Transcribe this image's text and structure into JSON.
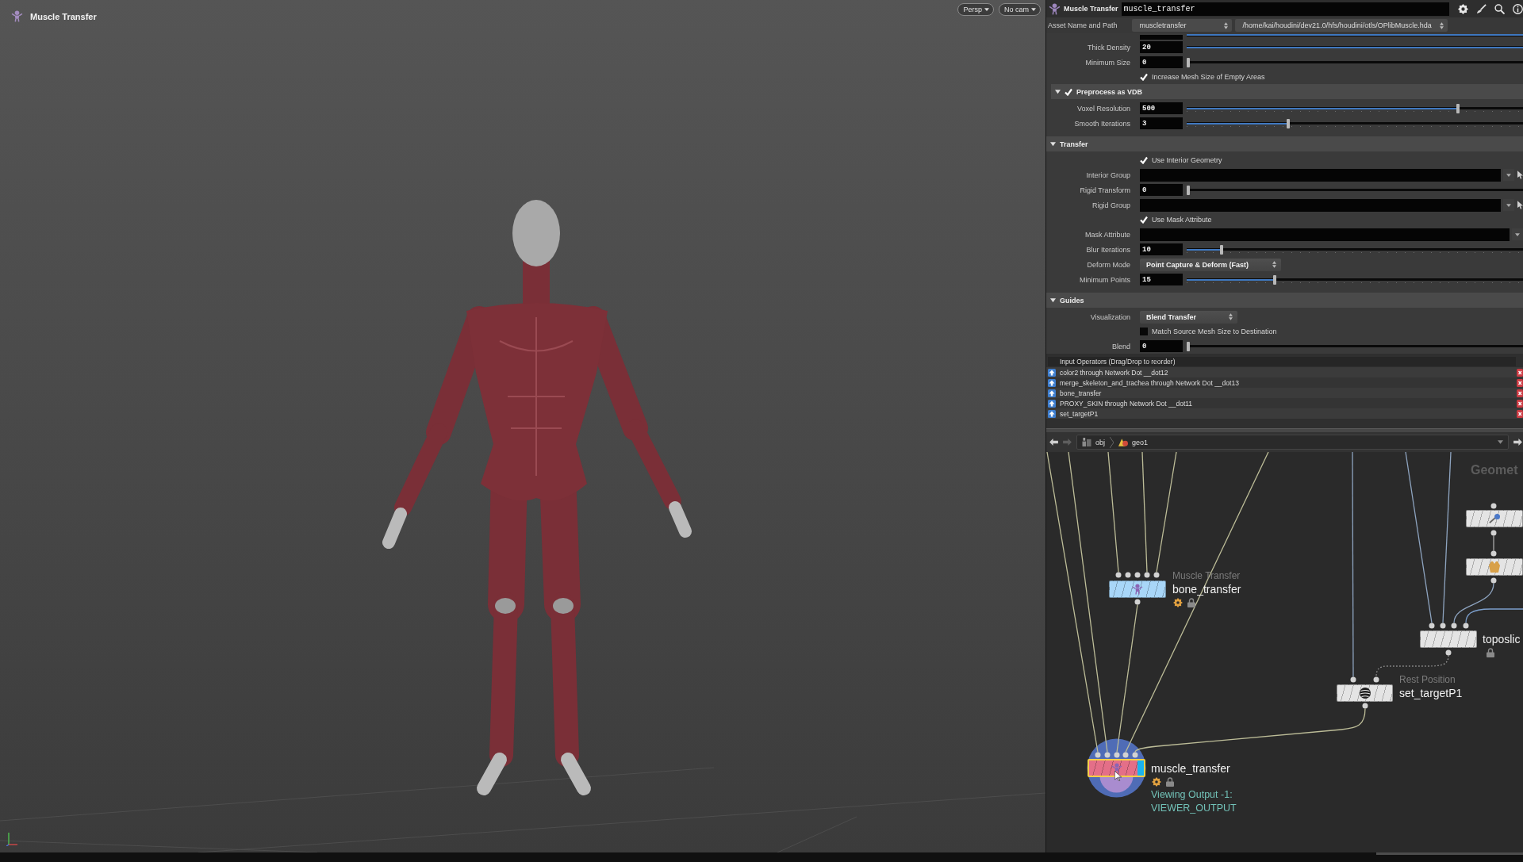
{
  "viewport": {
    "title": "Muscle Transfer",
    "buttons": [
      {
        "label": "Persp"
      },
      {
        "label": "No cam"
      }
    ]
  },
  "parameter_pane": {
    "node_type": "Muscle Transfer",
    "node_name": "muscle_transfer",
    "asset_label": "Asset Name and Path",
    "asset_name": "muscletransfer",
    "asset_path": "/home/kai/houdini/dev21.0/hfs/houdini/otls/OPlibMuscle.hda",
    "parameters": [
      {
        "kind": "folder",
        "children": [
          {
            "kind": "slider",
            "level": 1,
            "ticks": false
          },
          {
            "kind": "slider",
            "label": "Thick Density",
            "value": "20",
            "level": 1,
            "ticks": false
          },
          {
            "kind": "slider",
            "label": "Minimum Size",
            "value": "0",
            "level": 0,
            "ticks": false
          },
          {
            "kind": "checkbox",
            "label": "Increase Mesh Size of Empty Areas",
            "checked": true
          },
          {
            "kind": "folder",
            "label": "Preprocess as VDB",
            "expanded": true,
            "checked": true,
            "children": [
              {
                "kind": "slider",
                "label": "Voxel Resolution",
                "value": "500",
                "level": 0.81,
                "ticks": true
              },
              {
                "kind": "slider",
                "label": "Smooth Iterations",
                "value": "3",
                "level": 0.3,
                "ticks": true
              }
            ]
          }
        ]
      },
      {
        "kind": "folder",
        "label": "Transfer",
        "expanded": true,
        "children": [
          {
            "kind": "checkbox",
            "label": "Use Interior Geometry",
            "checked": true
          },
          {
            "kind": "string",
            "label": "Interior Group",
            "picker": true
          },
          {
            "kind": "slider",
            "label": "Rigid Transform",
            "value": "0",
            "level": 0,
            "ticks": false
          },
          {
            "kind": "string",
            "label": "Rigid Group",
            "picker": true
          },
          {
            "kind": "checkbox",
            "label": "Use Mask Attribute",
            "checked": true
          },
          {
            "kind": "string",
            "label": "Mask Attribute",
            "picker": false
          },
          {
            "kind": "slider",
            "label": "Blur Iterations",
            "value": "10",
            "level": 0.1,
            "ticks": true
          },
          {
            "kind": "menu",
            "label": "Deform Mode",
            "value": "Point Capture & Deform (Fast)"
          },
          {
            "kind": "slider",
            "label": "Minimum Points",
            "value": "15",
            "level": 0.26,
            "ticks": true
          }
        ]
      },
      {
        "kind": "folder",
        "label": "Guides",
        "expanded": true,
        "children": [
          {
            "kind": "menu",
            "label": "Visualization",
            "value": "Blend Transfer"
          },
          {
            "kind": "checkbox",
            "label": "Match Source Mesh Size to Destination",
            "checked": false
          },
          {
            "kind": "slider",
            "label": "Blend",
            "value": "0",
            "level": 0,
            "ticks": false
          }
        ]
      }
    ],
    "input_operators": {
      "header": "Input Operators (Drag/Drop to reorder)",
      "items": [
        {
          "label": "color2 through Network Dot __dot12"
        },
        {
          "label": "merge_skeleton_and_trachea through Network Dot __dot13"
        },
        {
          "label": "bone_transfer"
        },
        {
          "label": "PROXY_SKIN through Network Dot __dot11"
        },
        {
          "label": "set_targetP1"
        }
      ]
    }
  },
  "network_editor": {
    "back": {
      "disabled": false
    },
    "forward": {
      "disabled": true
    },
    "path": [
      {
        "label": "obj"
      },
      {
        "label": "geo1"
      }
    ],
    "context_label": "Geomet",
    "nodes": [
      {
        "color": "#e4e4e4",
        "selected": false,
        "display_flag": false,
        "gear_mark": false,
        "lock_mark": false
      },
      {
        "color": "#e4e4e4",
        "selected": false,
        "display_flag": false,
        "gear_mark": false,
        "lock_mark": false
      },
      {
        "type_label": "Muscle Transfer",
        "name": "bone_transfer",
        "color": "#a8d6f8",
        "selected": false,
        "display_flag": false,
        "gear_mark": true,
        "lock_mark": true
      },
      {
        "name": "toposlic",
        "color": "#e4e4e4",
        "selected": false,
        "display_flag": false,
        "gear_mark": false,
        "lock_mark": true
      },
      {
        "type_label": "Rest Position",
        "name": "set_targetP1",
        "color": "#e4e4e4",
        "selected": false,
        "display_flag": false,
        "gear_mark": false,
        "lock_mark": false
      },
      {
        "name": "muscle_transfer",
        "color": "#e46f88",
        "selected": true,
        "display_flag": true,
        "gear_mark": true,
        "lock_mark": true,
        "notes": [
          "Viewing Output -1:",
          "VIEWER_OUTPUT"
        ]
      }
    ]
  }
}
